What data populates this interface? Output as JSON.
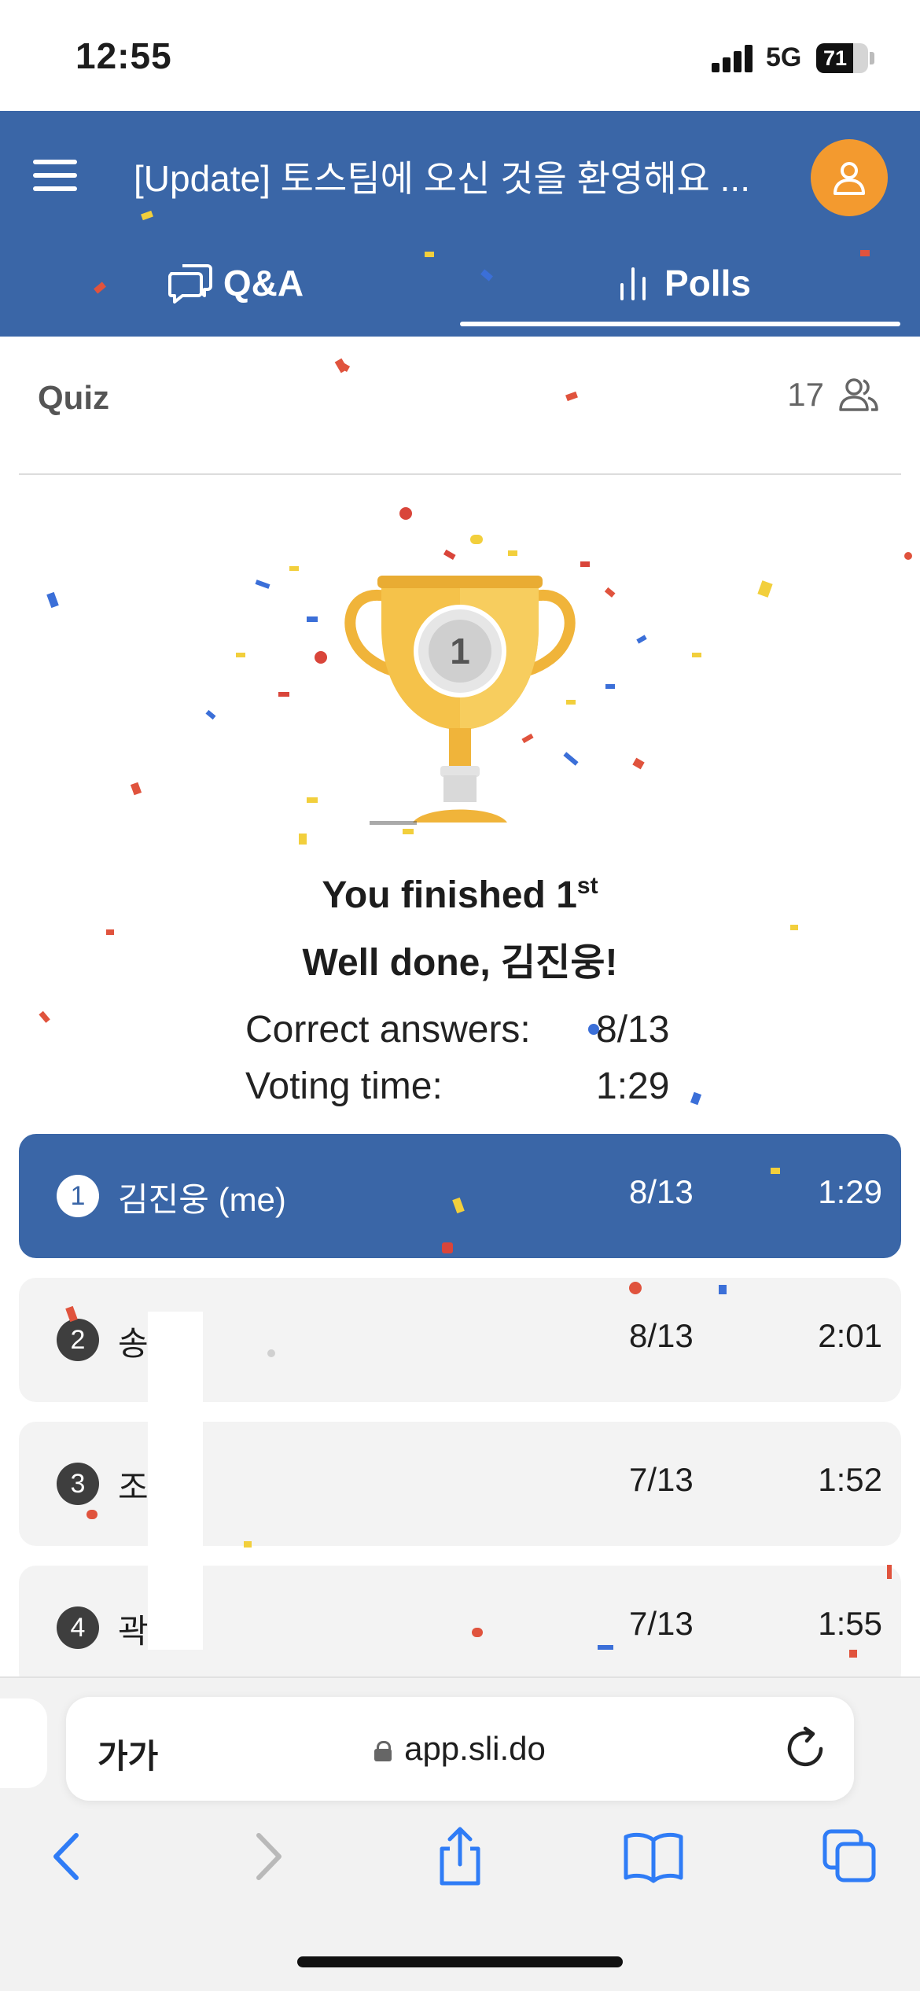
{
  "status_bar": {
    "time": "12:55",
    "network": "5G",
    "battery": "71",
    "battery_level": 0.71
  },
  "header": {
    "title": "[Update] 토스팀에 오신 것을 환영해요 ...",
    "tabs": [
      {
        "label": "Q&A",
        "icon": "chat-bubbles-icon",
        "active": false
      },
      {
        "label": "Polls",
        "icon": "bar-chart-icon",
        "active": true
      }
    ],
    "accent_color": "#3a66a7",
    "avatar_color": "#f39a2f"
  },
  "quiz": {
    "label": "Quiz",
    "participants": "17"
  },
  "result": {
    "line1_prefix": "You finished 1",
    "line1_suffix": "st",
    "line2": "Well done, 김진웅!",
    "trophy_rank": "1",
    "stats": [
      {
        "label": "Correct answers:",
        "value": "8/13"
      },
      {
        "label": "Voting time:",
        "value": "1:29"
      }
    ]
  },
  "leaderboard": [
    {
      "rank": "1",
      "name": "김진웅 (me)",
      "score": "8/13",
      "time": "1:29",
      "me": true
    },
    {
      "rank": "2",
      "name": "송",
      "score": "8/13",
      "time": "2:01",
      "me": false
    },
    {
      "rank": "3",
      "name": "조",
      "score": "7/13",
      "time": "1:52",
      "me": false
    },
    {
      "rank": "4",
      "name": "곽",
      "score": "7/13",
      "time": "1:55",
      "me": false
    }
  ],
  "browser": {
    "text_size_label": "가가",
    "url": "app.sli.do",
    "toolbar": [
      "back-icon",
      "forward-icon",
      "share-icon",
      "bookmarks-icon",
      "tabs-icon"
    ]
  }
}
